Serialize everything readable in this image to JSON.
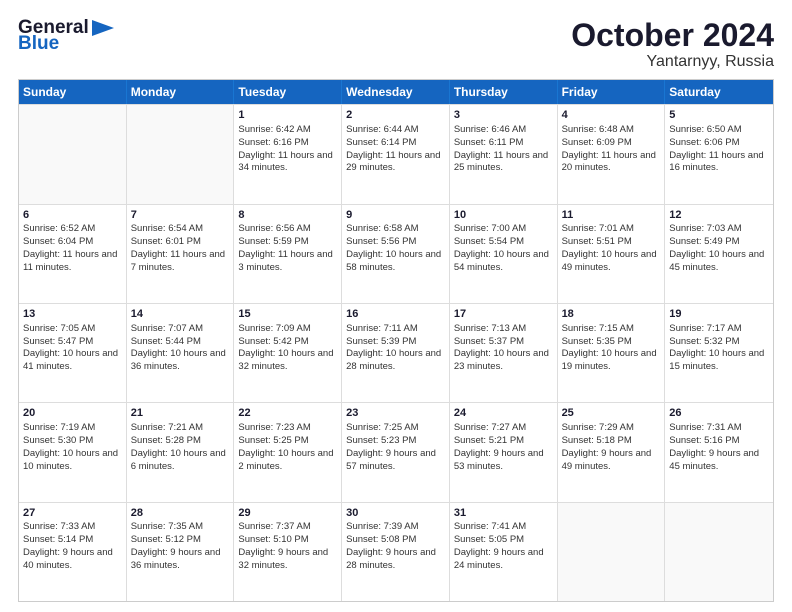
{
  "header": {
    "logo_general": "General",
    "logo_blue": "Blue",
    "month": "October 2024",
    "location": "Yantarnyy, Russia"
  },
  "days_of_week": [
    "Sunday",
    "Monday",
    "Tuesday",
    "Wednesday",
    "Thursday",
    "Friday",
    "Saturday"
  ],
  "weeks": [
    [
      {
        "day": "",
        "sunrise": "",
        "sunset": "",
        "daylight": "",
        "empty": true
      },
      {
        "day": "",
        "sunrise": "",
        "sunset": "",
        "daylight": "",
        "empty": true
      },
      {
        "day": "1",
        "sunrise": "Sunrise: 6:42 AM",
        "sunset": "Sunset: 6:16 PM",
        "daylight": "Daylight: 11 hours and 34 minutes.",
        "empty": false
      },
      {
        "day": "2",
        "sunrise": "Sunrise: 6:44 AM",
        "sunset": "Sunset: 6:14 PM",
        "daylight": "Daylight: 11 hours and 29 minutes.",
        "empty": false
      },
      {
        "day": "3",
        "sunrise": "Sunrise: 6:46 AM",
        "sunset": "Sunset: 6:11 PM",
        "daylight": "Daylight: 11 hours and 25 minutes.",
        "empty": false
      },
      {
        "day": "4",
        "sunrise": "Sunrise: 6:48 AM",
        "sunset": "Sunset: 6:09 PM",
        "daylight": "Daylight: 11 hours and 20 minutes.",
        "empty": false
      },
      {
        "day": "5",
        "sunrise": "Sunrise: 6:50 AM",
        "sunset": "Sunset: 6:06 PM",
        "daylight": "Daylight: 11 hours and 16 minutes.",
        "empty": false
      }
    ],
    [
      {
        "day": "6",
        "sunrise": "Sunrise: 6:52 AM",
        "sunset": "Sunset: 6:04 PM",
        "daylight": "Daylight: 11 hours and 11 minutes.",
        "empty": false
      },
      {
        "day": "7",
        "sunrise": "Sunrise: 6:54 AM",
        "sunset": "Sunset: 6:01 PM",
        "daylight": "Daylight: 11 hours and 7 minutes.",
        "empty": false
      },
      {
        "day": "8",
        "sunrise": "Sunrise: 6:56 AM",
        "sunset": "Sunset: 5:59 PM",
        "daylight": "Daylight: 11 hours and 3 minutes.",
        "empty": false
      },
      {
        "day": "9",
        "sunrise": "Sunrise: 6:58 AM",
        "sunset": "Sunset: 5:56 PM",
        "daylight": "Daylight: 10 hours and 58 minutes.",
        "empty": false
      },
      {
        "day": "10",
        "sunrise": "Sunrise: 7:00 AM",
        "sunset": "Sunset: 5:54 PM",
        "daylight": "Daylight: 10 hours and 54 minutes.",
        "empty": false
      },
      {
        "day": "11",
        "sunrise": "Sunrise: 7:01 AM",
        "sunset": "Sunset: 5:51 PM",
        "daylight": "Daylight: 10 hours and 49 minutes.",
        "empty": false
      },
      {
        "day": "12",
        "sunrise": "Sunrise: 7:03 AM",
        "sunset": "Sunset: 5:49 PM",
        "daylight": "Daylight: 10 hours and 45 minutes.",
        "empty": false
      }
    ],
    [
      {
        "day": "13",
        "sunrise": "Sunrise: 7:05 AM",
        "sunset": "Sunset: 5:47 PM",
        "daylight": "Daylight: 10 hours and 41 minutes.",
        "empty": false
      },
      {
        "day": "14",
        "sunrise": "Sunrise: 7:07 AM",
        "sunset": "Sunset: 5:44 PM",
        "daylight": "Daylight: 10 hours and 36 minutes.",
        "empty": false
      },
      {
        "day": "15",
        "sunrise": "Sunrise: 7:09 AM",
        "sunset": "Sunset: 5:42 PM",
        "daylight": "Daylight: 10 hours and 32 minutes.",
        "empty": false
      },
      {
        "day": "16",
        "sunrise": "Sunrise: 7:11 AM",
        "sunset": "Sunset: 5:39 PM",
        "daylight": "Daylight: 10 hours and 28 minutes.",
        "empty": false
      },
      {
        "day": "17",
        "sunrise": "Sunrise: 7:13 AM",
        "sunset": "Sunset: 5:37 PM",
        "daylight": "Daylight: 10 hours and 23 minutes.",
        "empty": false
      },
      {
        "day": "18",
        "sunrise": "Sunrise: 7:15 AM",
        "sunset": "Sunset: 5:35 PM",
        "daylight": "Daylight: 10 hours and 19 minutes.",
        "empty": false
      },
      {
        "day": "19",
        "sunrise": "Sunrise: 7:17 AM",
        "sunset": "Sunset: 5:32 PM",
        "daylight": "Daylight: 10 hours and 15 minutes.",
        "empty": false
      }
    ],
    [
      {
        "day": "20",
        "sunrise": "Sunrise: 7:19 AM",
        "sunset": "Sunset: 5:30 PM",
        "daylight": "Daylight: 10 hours and 10 minutes.",
        "empty": false
      },
      {
        "day": "21",
        "sunrise": "Sunrise: 7:21 AM",
        "sunset": "Sunset: 5:28 PM",
        "daylight": "Daylight: 10 hours and 6 minutes.",
        "empty": false
      },
      {
        "day": "22",
        "sunrise": "Sunrise: 7:23 AM",
        "sunset": "Sunset: 5:25 PM",
        "daylight": "Daylight: 10 hours and 2 minutes.",
        "empty": false
      },
      {
        "day": "23",
        "sunrise": "Sunrise: 7:25 AM",
        "sunset": "Sunset: 5:23 PM",
        "daylight": "Daylight: 9 hours and 57 minutes.",
        "empty": false
      },
      {
        "day": "24",
        "sunrise": "Sunrise: 7:27 AM",
        "sunset": "Sunset: 5:21 PM",
        "daylight": "Daylight: 9 hours and 53 minutes.",
        "empty": false
      },
      {
        "day": "25",
        "sunrise": "Sunrise: 7:29 AM",
        "sunset": "Sunset: 5:18 PM",
        "daylight": "Daylight: 9 hours and 49 minutes.",
        "empty": false
      },
      {
        "day": "26",
        "sunrise": "Sunrise: 7:31 AM",
        "sunset": "Sunset: 5:16 PM",
        "daylight": "Daylight: 9 hours and 45 minutes.",
        "empty": false
      }
    ],
    [
      {
        "day": "27",
        "sunrise": "Sunrise: 7:33 AM",
        "sunset": "Sunset: 5:14 PM",
        "daylight": "Daylight: 9 hours and 40 minutes.",
        "empty": false
      },
      {
        "day": "28",
        "sunrise": "Sunrise: 7:35 AM",
        "sunset": "Sunset: 5:12 PM",
        "daylight": "Daylight: 9 hours and 36 minutes.",
        "empty": false
      },
      {
        "day": "29",
        "sunrise": "Sunrise: 7:37 AM",
        "sunset": "Sunset: 5:10 PM",
        "daylight": "Daylight: 9 hours and 32 minutes.",
        "empty": false
      },
      {
        "day": "30",
        "sunrise": "Sunrise: 7:39 AM",
        "sunset": "Sunset: 5:08 PM",
        "daylight": "Daylight: 9 hours and 28 minutes.",
        "empty": false
      },
      {
        "day": "31",
        "sunrise": "Sunrise: 7:41 AM",
        "sunset": "Sunset: 5:05 PM",
        "daylight": "Daylight: 9 hours and 24 minutes.",
        "empty": false
      },
      {
        "day": "",
        "sunrise": "",
        "sunset": "",
        "daylight": "",
        "empty": true
      },
      {
        "day": "",
        "sunrise": "",
        "sunset": "",
        "daylight": "",
        "empty": true
      }
    ]
  ]
}
